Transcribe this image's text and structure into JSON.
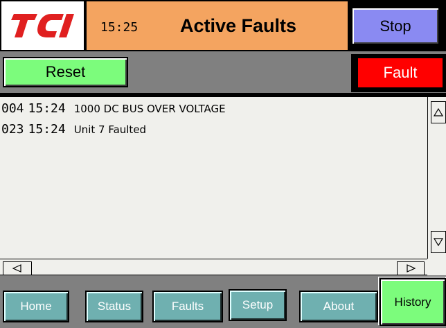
{
  "header": {
    "logo_text": "TCI",
    "time": "15:25",
    "title": "Active Faults",
    "stop_label": "Stop"
  },
  "controls": {
    "reset_label": "Reset",
    "fault_label": "Fault"
  },
  "faults": [
    {
      "code": "004",
      "time": "15:24",
      "description": "1000 DC BUS OVER VOLTAGE"
    },
    {
      "code": "023",
      "time": "15:24",
      "description": "Unit 7 Faulted"
    }
  ],
  "scroll": {
    "up_icon": "up-triangle-icon",
    "down_icon": "down-triangle-icon",
    "left_icon": "left-triangle-icon",
    "right_icon": "right-triangle-icon"
  },
  "nav": {
    "home": "Home",
    "status": "Status",
    "faults": "Faults",
    "setup": "Setup",
    "about": "About",
    "history": "History"
  },
  "colors": {
    "header_bg": "#f4a460",
    "stop_bg": "#8a8af2",
    "reset_bg": "#7cfc7c",
    "fault_bg": "#ff0000",
    "nav_bg": "#6fb0b0",
    "logo_red": "#e02020"
  }
}
